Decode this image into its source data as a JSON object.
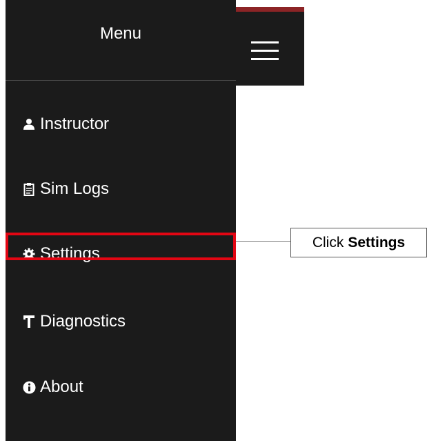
{
  "menu": {
    "title": "Menu",
    "items": [
      {
        "label": "Instructor",
        "icon": "user-icon"
      },
      {
        "label": "Sim Logs",
        "icon": "clipboard-icon"
      },
      {
        "label": "Settings",
        "icon": "gear-icon"
      },
      {
        "label": "Diagnostics",
        "icon": "hammer-icon"
      },
      {
        "label": "About",
        "icon": "info-icon"
      }
    ]
  },
  "topbar": {
    "menu_button_icon": "hamburger-icon"
  },
  "callout": {
    "prefix": "Click",
    "target": "Settings"
  },
  "colors": {
    "sidebar_bg": "#1b1b1b",
    "highlight": "#e30613",
    "topbar_accent": "#8c2426"
  }
}
